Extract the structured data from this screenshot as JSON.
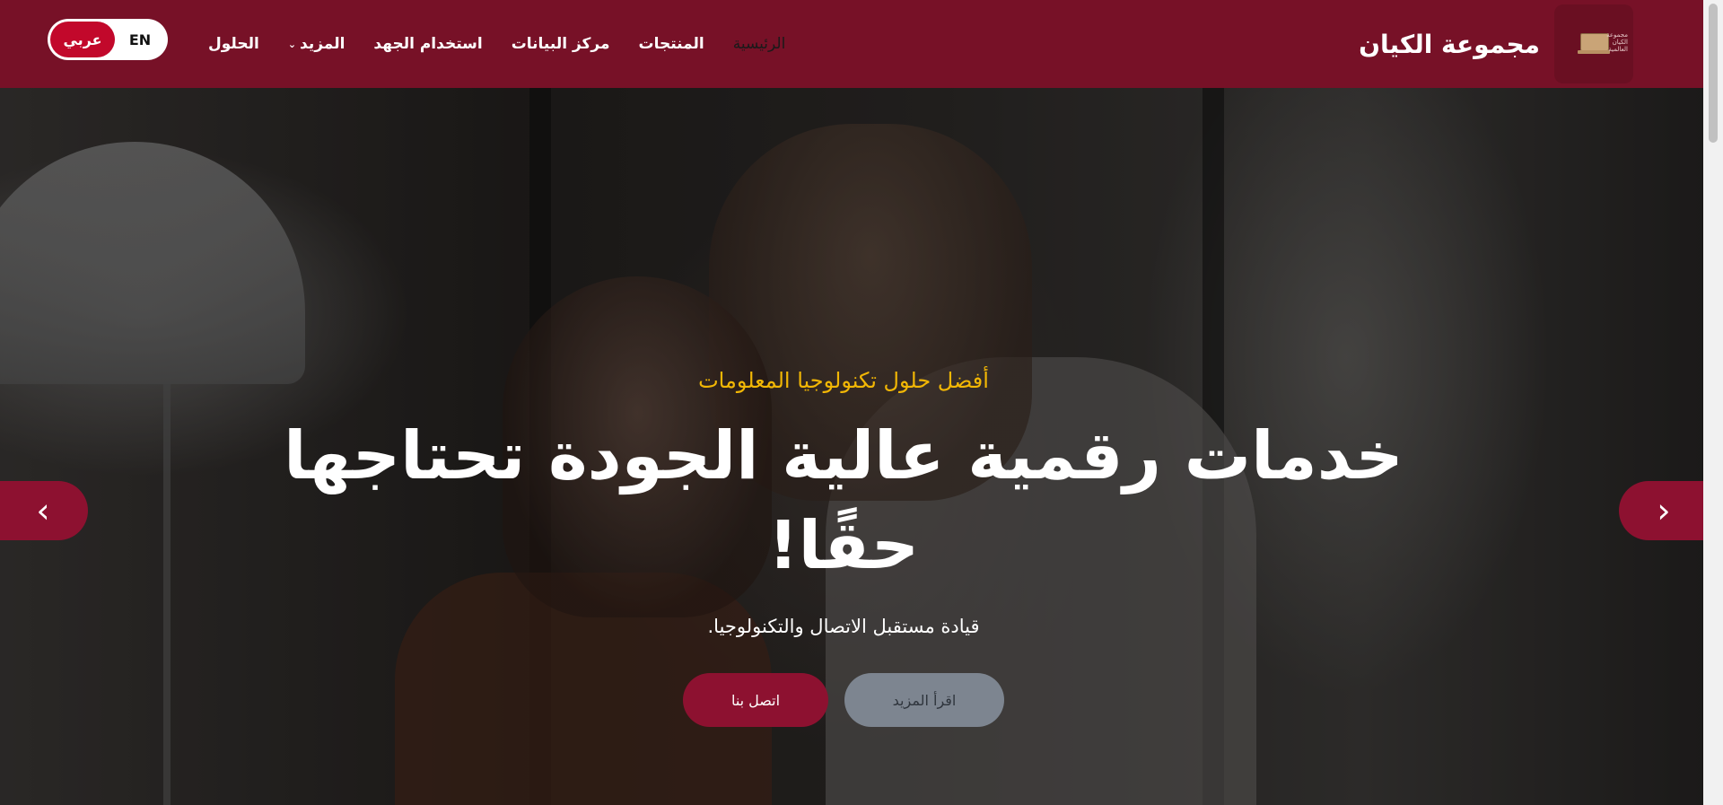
{
  "header": {
    "brand_name": "مجموعة الكيان",
    "logo_text": "مجموعة الكيان العالمية",
    "nav": [
      {
        "label": "الرئيسية",
        "active": true
      },
      {
        "label": "المنتجات"
      },
      {
        "label": "مركز البيانات"
      },
      {
        "label": "استخدام الجهد"
      },
      {
        "label": "المزيد",
        "has_dropdown": true
      },
      {
        "label": "الحلول"
      }
    ],
    "lang_ar": "عربي",
    "lang_en": "EN"
  },
  "hero": {
    "eyebrow": "أفضل حلول تكنولوجيا المعلومات",
    "title": "خدمات رقمية عالية الجودة تحتاجها حقًا!",
    "subtitle": "قيادة مستقبل الاتصال والتكنولوجيا.",
    "btn_more": "اقرأ المزيد",
    "btn_contact": "اتصل بنا",
    "prev_glyph": "‹",
    "next_glyph": "›"
  },
  "colors": {
    "primary": "#771127",
    "accent": "#f2b705",
    "button": "#8d1130"
  }
}
